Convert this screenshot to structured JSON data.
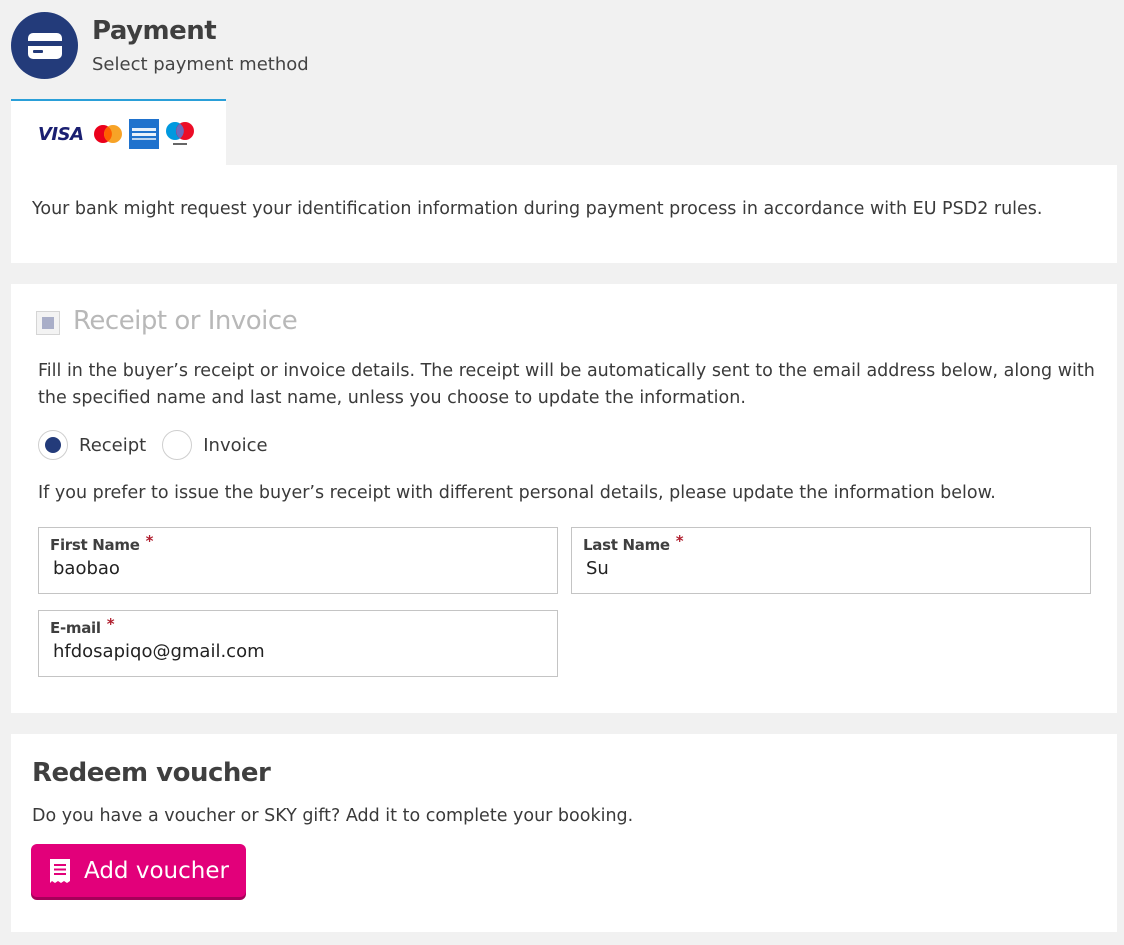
{
  "header": {
    "title": "Payment",
    "subtitle": "Select payment method",
    "icon": "credit-card-icon"
  },
  "payment_tab": {
    "visa_text": "VISA",
    "logos": [
      "visa-logo",
      "mastercard-logo",
      "american-express-logo",
      "maestro-logo"
    ]
  },
  "psd2_notice": "Your bank might request your identification information during payment process in accordance with EU PSD2 rules.",
  "receipt": {
    "title": "Receipt or Invoice",
    "description": "Fill in the buyer’s receipt or invoice details. The receipt will be automatically sent to the email address below, along with the specified name and last name, unless you choose to update the information.",
    "options": [
      {
        "label": "Receipt",
        "selected": true
      },
      {
        "label": "Invoice",
        "selected": false
      }
    ],
    "update_note": "If you prefer to issue the buyer’s receipt with different personal details, please update the information below.",
    "fields": {
      "first_name": {
        "label": "First Name",
        "required_mark": "*",
        "value": "baobao"
      },
      "last_name": {
        "label": "Last Name",
        "required_mark": "*",
        "value": "Su"
      },
      "email": {
        "label": "E-mail",
        "required_mark": "*",
        "value": "hfdosapiqo@gmail.com"
      }
    }
  },
  "voucher": {
    "title": "Redeem voucher",
    "description": "Do you have a voucher or SKY gift? Add it to complete your booking.",
    "button_label": "Add voucher",
    "button_icon": "voucher-receipt-icon"
  },
  "colors": {
    "background": "#f1f1f1",
    "primary_navy": "#233b7a",
    "tab_accent": "#2a9fd8",
    "button_pink": "#e2007a",
    "required_red": "#b01e2e"
  }
}
